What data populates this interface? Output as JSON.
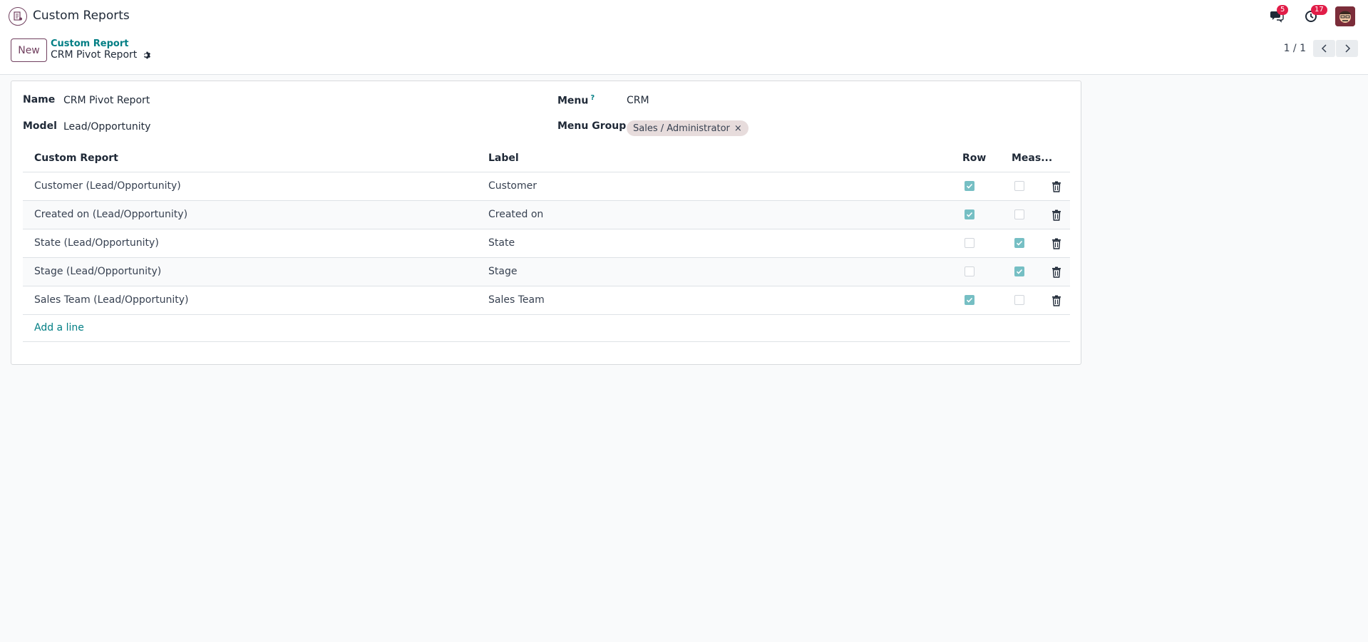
{
  "navbar": {
    "app_title": "Custom Reports",
    "messages_badge": "5",
    "activities_badge": "17"
  },
  "control_panel": {
    "new_label": "New",
    "breadcrumb": "Custom Report",
    "record_title": "CRM Pivot Report",
    "pager": "1 / 1"
  },
  "form": {
    "name_label": "Name",
    "name_value": "CRM Pivot Report",
    "model_label": "Model",
    "model_value": "Lead/Opportunity",
    "menu_label": "Menu",
    "menu_help": "?",
    "menu_value": "CRM",
    "menu_group_label": "Menu Group",
    "menu_group_tag": "Sales / Administrator",
    "tag_remove": "×"
  },
  "table": {
    "headers": {
      "custom_report": "Custom Report",
      "label": "Label",
      "row": "Row",
      "measure": "Meas..."
    },
    "rows": [
      {
        "report": "Customer (Lead/Opportunity)",
        "label": "Customer",
        "row": true,
        "measure": false
      },
      {
        "report": "Created on (Lead/Opportunity)",
        "label": "Created on",
        "row": true,
        "measure": false
      },
      {
        "report": "State (Lead/Opportunity)",
        "label": "State",
        "row": false,
        "measure": true
      },
      {
        "report": "Stage (Lead/Opportunity)",
        "label": "Stage",
        "row": false,
        "measure": true
      },
      {
        "report": "Sales Team (Lead/Opportunity)",
        "label": "Sales Team",
        "row": true,
        "measure": false
      }
    ],
    "add_line": "Add a line"
  },
  "colors": {
    "brand": "#71405f",
    "link": "#017e84",
    "checkbox_checked": "#76bfc4",
    "badge": "#e11d48"
  }
}
